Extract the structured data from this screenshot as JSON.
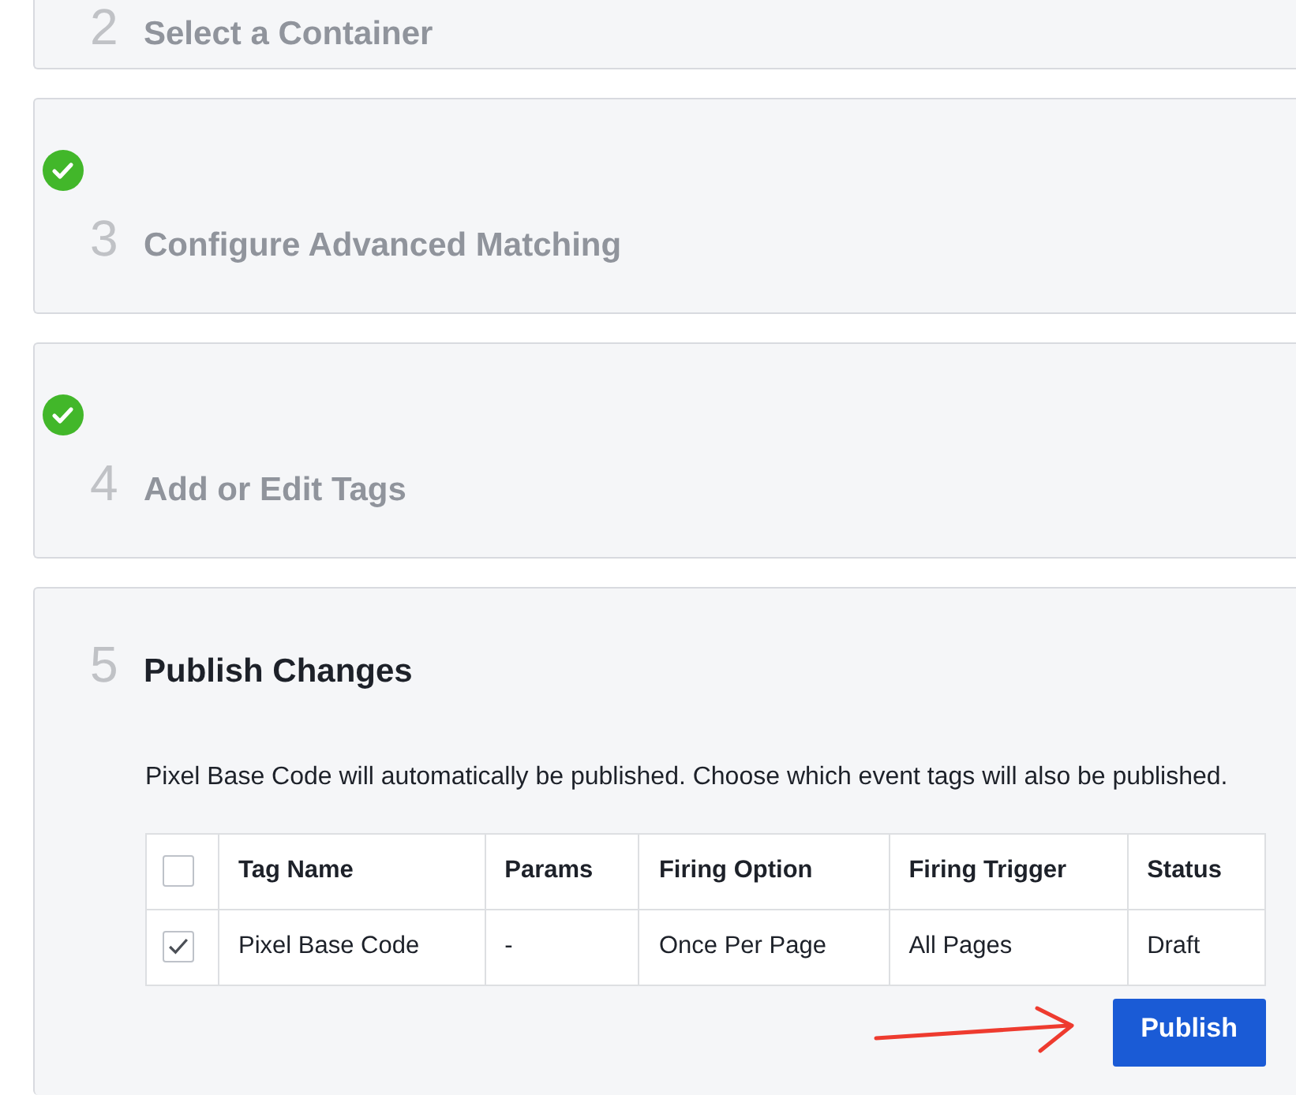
{
  "steps": [
    {
      "number": "2",
      "title": "Select a Container",
      "done": false,
      "current": false
    },
    {
      "number": "3",
      "title": "Configure Advanced Matching",
      "done": true,
      "current": false
    },
    {
      "number": "4",
      "title": "Add or Edit Tags",
      "done": true,
      "current": false
    },
    {
      "number": "5",
      "title": "Publish Changes",
      "done": false,
      "current": true,
      "description": "Pixel Base Code will automatically be published. Choose which event tags will also be published.",
      "table": {
        "select_all_checked": false,
        "columns": [
          "Tag Name",
          "Params",
          "Firing Option",
          "Firing Trigger",
          "Status"
        ],
        "rows": [
          {
            "checked": true,
            "cells": [
              "Pixel Base Code",
              "-",
              "Once Per Page",
              "All Pages",
              "Draft"
            ]
          }
        ]
      },
      "button": "Publish"
    }
  ]
}
